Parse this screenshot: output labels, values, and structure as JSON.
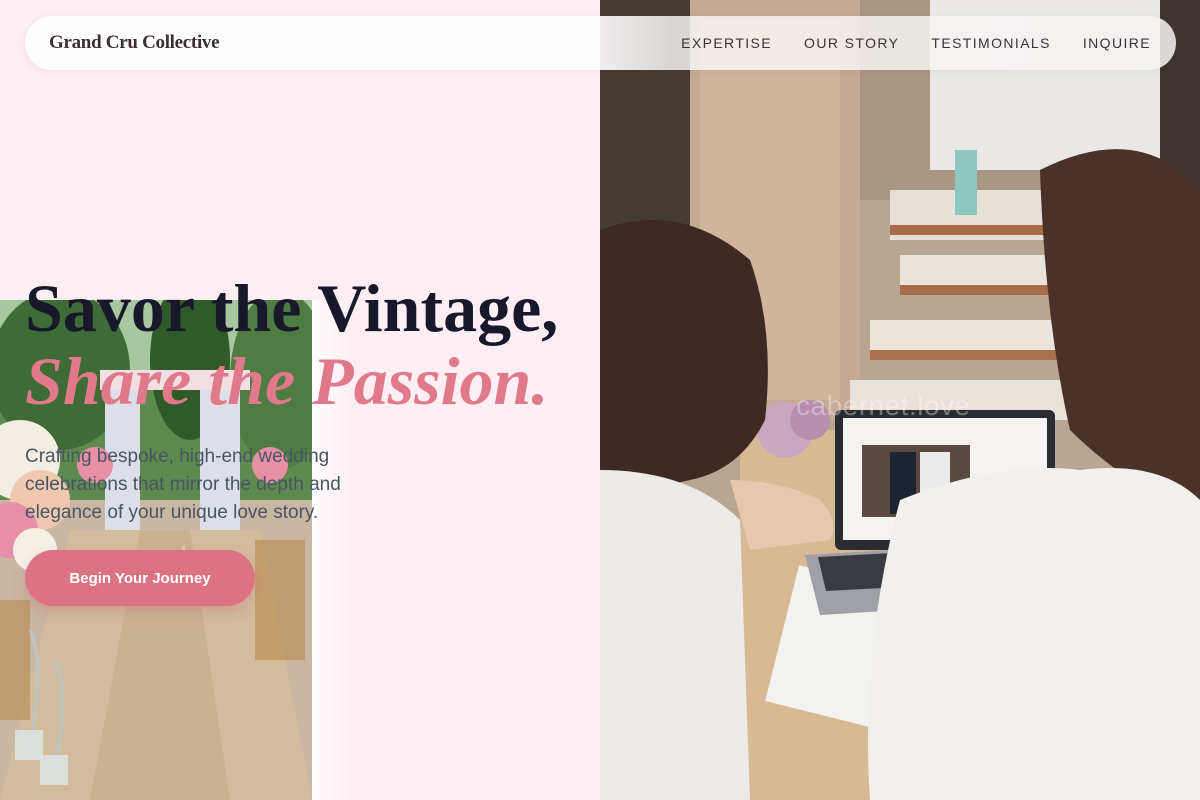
{
  "nav": {
    "brand": "Grand Cru Collective",
    "links": [
      "EXPERTISE",
      "OUR STORY",
      "TESTIMONIALS",
      "INQUIRE"
    ]
  },
  "hero": {
    "headline": "Savor the Vintage,",
    "headline_accent": "Share the Passion.",
    "subtitle": "Crafting bespoke, high-end wedding celebrations that mirror the depth and elegance of your unique love story.",
    "cta_label": "Begin Your Journey"
  },
  "images": {
    "aisle_photo": "wedding-aisle-photo",
    "planners_photo": "two-women-reviewing-laptop-photo",
    "watermark": "cabernet.love"
  },
  "colors": {
    "background": "#ffeef3",
    "accent": "#e07a8a",
    "cta": "#dc7382",
    "headline": "#17182a",
    "body_text": "#4a5563"
  }
}
